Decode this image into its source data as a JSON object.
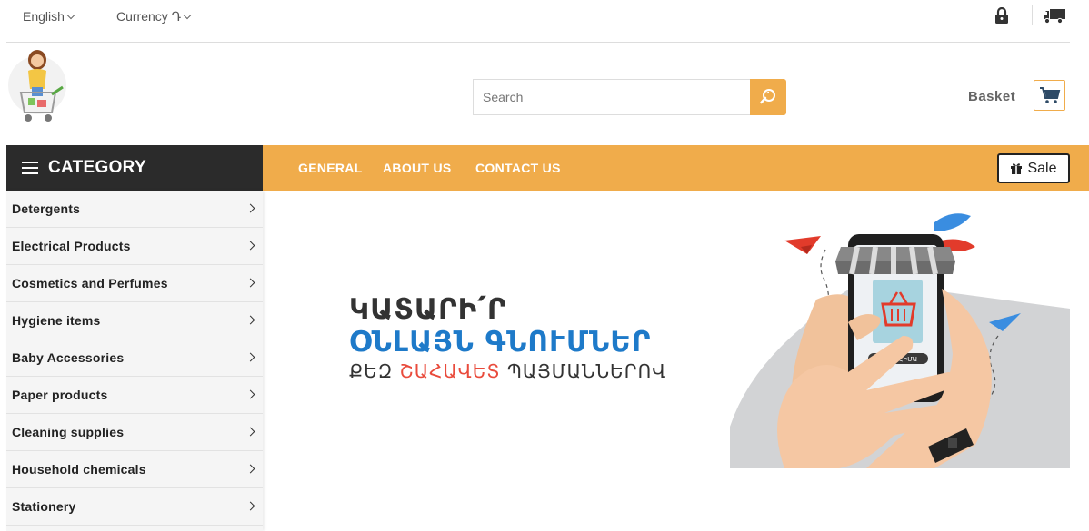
{
  "topbar": {
    "language": "English",
    "currency": "Currency Դ"
  },
  "search": {
    "placeholder": "Search"
  },
  "header": {
    "basket_label": "Basket"
  },
  "category": {
    "title": "CATEGORY",
    "items": [
      {
        "label": "Detergents"
      },
      {
        "label": "Electrical Products"
      },
      {
        "label": "Cosmetics and Perfumes"
      },
      {
        "label": "Hygiene items"
      },
      {
        "label": "Baby Accessories"
      },
      {
        "label": "Paper products"
      },
      {
        "label": "Cleaning supplies"
      },
      {
        "label": "Household chemicals"
      },
      {
        "label": "Stationery"
      }
    ]
  },
  "nav": {
    "links": [
      {
        "label": "GENERAL"
      },
      {
        "label": "ABOUT US"
      },
      {
        "label": "CONTACT US"
      }
    ],
    "sale_label": "Sale"
  },
  "banner": {
    "line1": "ԿԱՏԱՐԻ՛Ր",
    "line2": "ՕՆԼԱՅՆ ԳՆՈՒՄՆԵՐ",
    "line3_prefix": "ՔԵԶ ",
    "line3_highlight": "ՇԱՀԱՎԵՏ",
    "line3_suffix": " ՊԱՅՄԱՆՆԵՐՈՎ",
    "phone_button": "ԳՆԵԼ ՀԻՄԱ"
  },
  "colors": {
    "accent": "#f0ac4b",
    "dark": "#2b2b2b",
    "blue": "#1e7ac9",
    "red": "#e94b3c"
  }
}
